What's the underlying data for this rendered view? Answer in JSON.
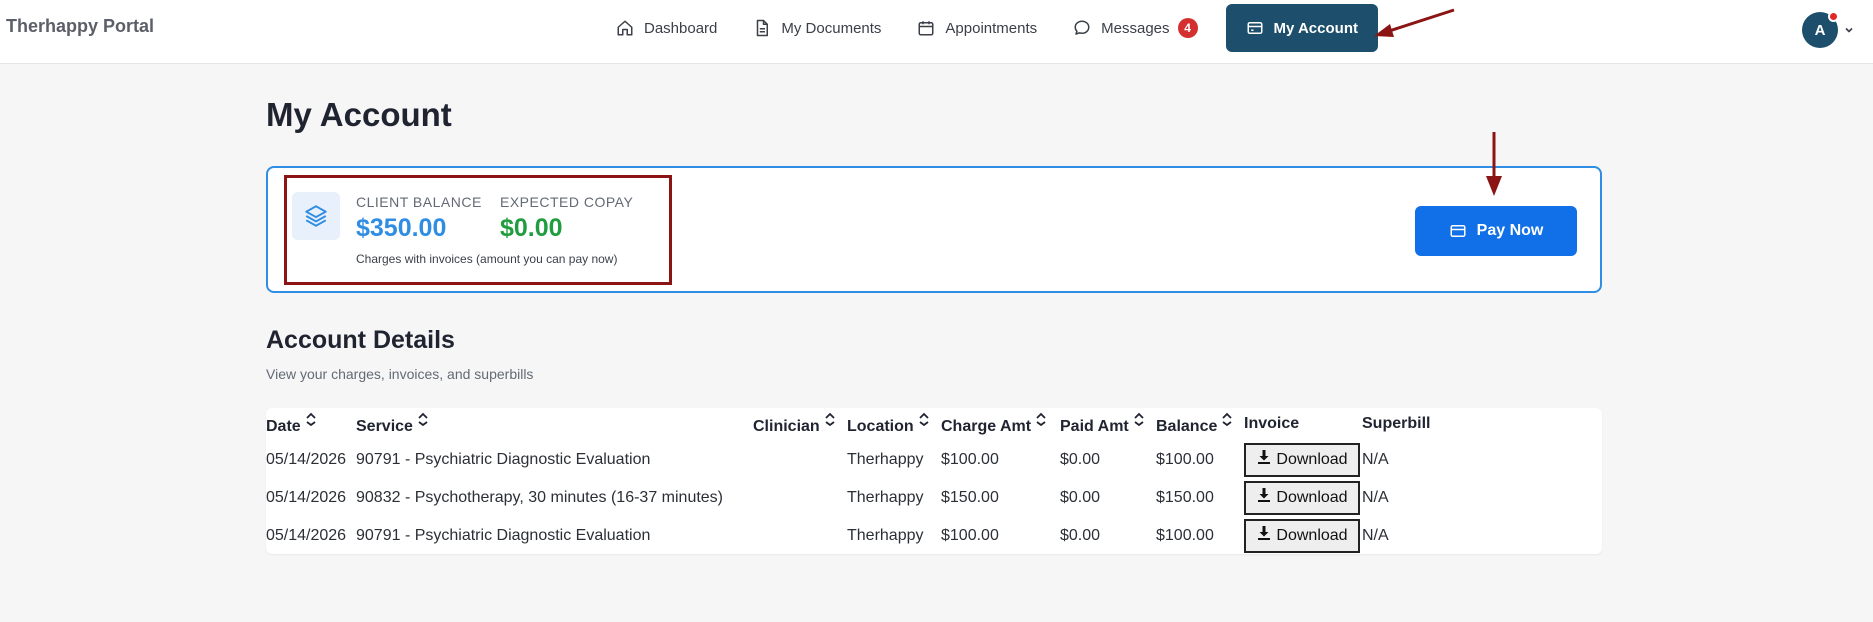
{
  "app": {
    "brand": "Therhappy Portal"
  },
  "nav": {
    "dashboard": "Dashboard",
    "documents": "My Documents",
    "appointments": "Appointments",
    "messages": "Messages",
    "messages_badge": "4",
    "account": "My Account"
  },
  "user": {
    "initial": "A"
  },
  "page": {
    "title": "My Account"
  },
  "balance": {
    "client_label": "CLIENT BALANCE",
    "client_value": "$350.00",
    "copay_label": "EXPECTED COPAY",
    "copay_value": "$0.00",
    "note": "Charges with invoices (amount you can pay now)",
    "pay_label": "Pay Now"
  },
  "details": {
    "title": "Account Details",
    "subtitle": "View your charges, invoices, and superbills",
    "columns": {
      "date": "Date",
      "service": "Service",
      "clinician": "Clinician",
      "location": "Location",
      "charge": "Charge Amt",
      "paid": "Paid Amt",
      "balance": "Balance",
      "invoice": "Invoice",
      "superbill": "Superbill"
    },
    "rows": [
      {
        "date": "05/14/2026",
        "service": "90791 - Psychiatric Diagnostic Evaluation",
        "clinician": "",
        "location": "Therhappy",
        "charge": "$100.00",
        "paid": "$0.00",
        "balance": "$100.00",
        "invoice": "Download",
        "superbill": "N/A"
      },
      {
        "date": "05/14/2026",
        "service": "90832 - Psychotherapy, 30 minutes (16-37 minutes)",
        "clinician": "",
        "location": "Therhappy",
        "charge": "$150.00",
        "paid": "$0.00",
        "balance": "$150.00",
        "invoice": "Download",
        "superbill": "N/A"
      },
      {
        "date": "05/14/2026",
        "service": "90791 - Psychiatric Diagnostic Evaluation",
        "clinician": "",
        "location": "Therhappy",
        "charge": "$100.00",
        "paid": "$0.00",
        "balance": "$100.00",
        "invoice": "Download",
        "superbill": "N/A"
      }
    ]
  },
  "colors": {
    "accent": "#1d4e6b",
    "primary": "#1170e8",
    "balance": "#2f8de4",
    "copay": "#1f9d3f",
    "annotation": "#8b1414"
  }
}
